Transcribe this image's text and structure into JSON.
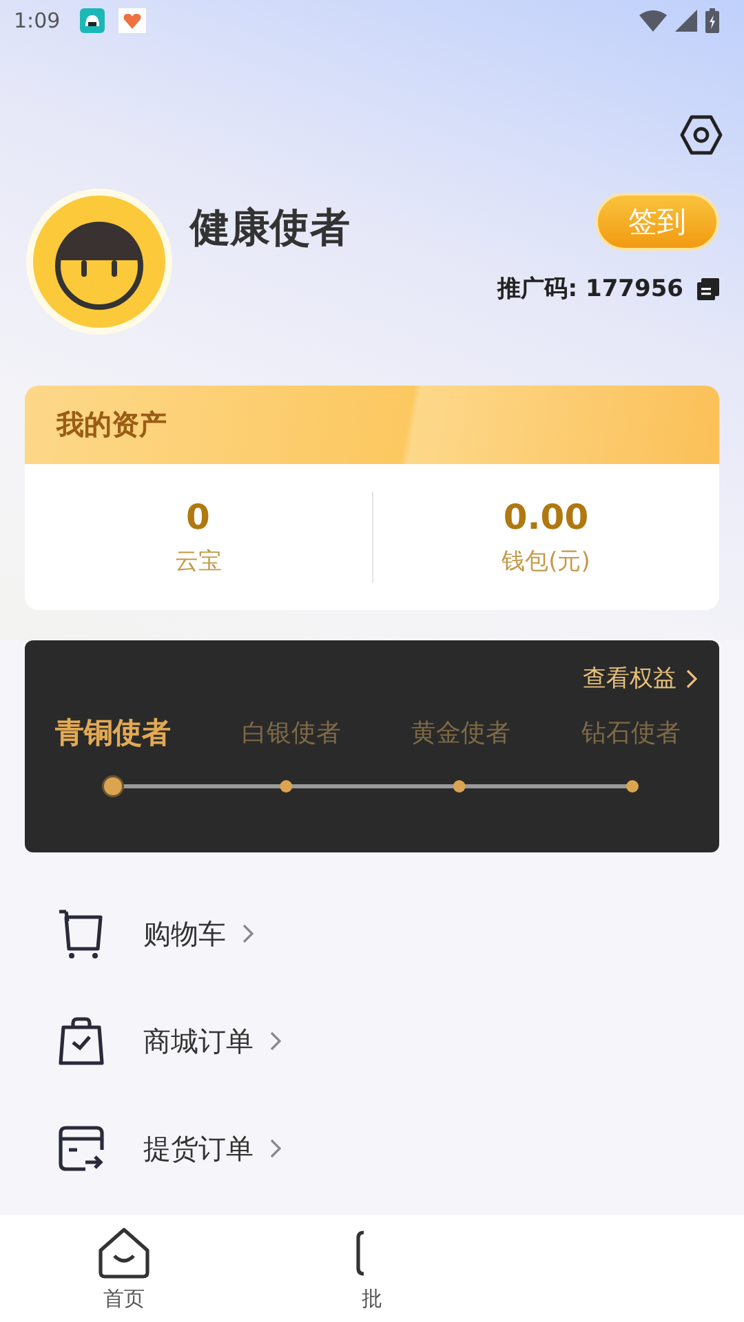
{
  "status_bar": {
    "time": "1:09"
  },
  "profile": {
    "name": "健康使者",
    "sign_in_button": "签到",
    "promo_code_label": "推广码:",
    "promo_code": "177956"
  },
  "assets": {
    "title": "我的资产",
    "items": [
      {
        "value": "0",
        "label": "云宝"
      },
      {
        "value": "0.00",
        "label": "钱包(元)"
      }
    ]
  },
  "membership": {
    "link": "查看权益",
    "tiers": [
      {
        "label": "青铜使者",
        "selected": true
      },
      {
        "label": "白银使者",
        "selected": false
      },
      {
        "label": "黄金使者",
        "selected": false
      },
      {
        "label": "钻石使者",
        "selected": false
      }
    ]
  },
  "menu": [
    {
      "kind": "cart",
      "label": "购物车"
    },
    {
      "kind": "bag",
      "label": "商城订单"
    },
    {
      "kind": "pickup",
      "label": "提货订单"
    }
  ],
  "bottom_nav": [
    {
      "kind": "home",
      "label": "首页"
    },
    {
      "kind": "wholesale",
      "label": "批"
    }
  ]
}
